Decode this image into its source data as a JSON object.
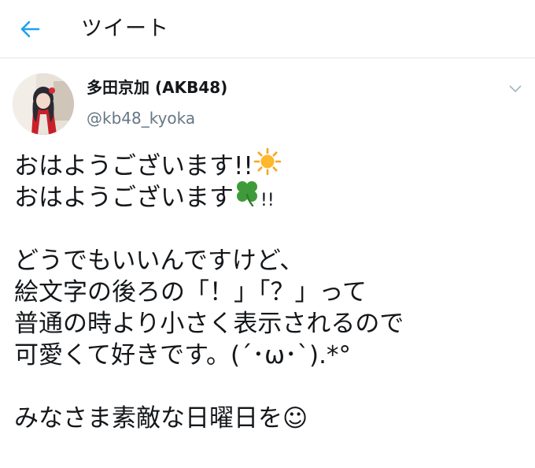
{
  "header": {
    "title": "ツイート"
  },
  "tweet": {
    "author": {
      "display_name": "多田京加 (AKB48)",
      "handle": "@kb48_kyoka"
    },
    "text": {
      "line1": "おはようございます!!",
      "line2a": "おはようございます",
      "line2b": "!!",
      "line4": "どうでもいいんですけど、",
      "line5": "絵文字の後ろの「！」「？」って",
      "line6": "普通の時より小さく表示されるので",
      "line7": "可愛くて好きです。(´･ω･`).*°",
      "line9": "みなさま素敵な日曜日を☺"
    },
    "emojis": {
      "line1": "sun-emoji",
      "line2": "four-leaf-clover-emoji"
    }
  },
  "colors": {
    "accent": "#1da1f2",
    "text": "#14171a",
    "secondary_text": "#657786",
    "divider": "#e3e6e8"
  }
}
